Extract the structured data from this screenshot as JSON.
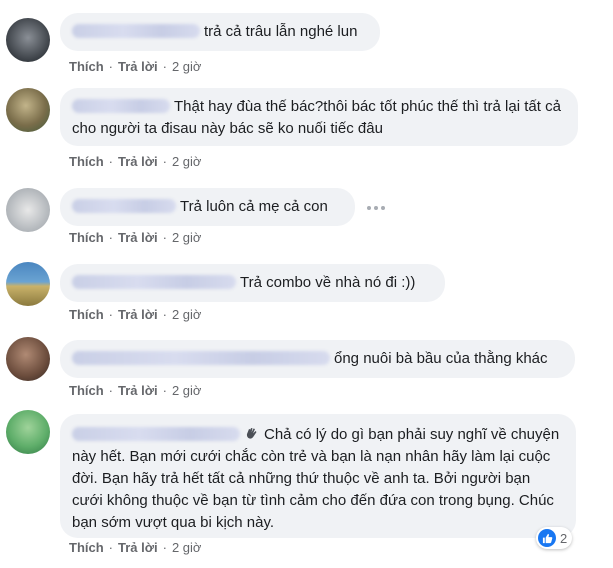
{
  "comments": [
    {
      "text": "trả cả trâu lẫn nghé lun",
      "like": "Thích",
      "reply": "Trả lời",
      "time": "2 giờ"
    },
    {
      "text": "Thật hay đùa thế bác?thôi bác tốt phúc thế thì trả lại tất cả cho người ta đisau này bác sẽ ko nuối tiếc đâu",
      "like": "Thích",
      "reply": "Trả lời",
      "time": "2 giờ"
    },
    {
      "text": "Trả luôn cả mẹ cả con",
      "like": "Thích",
      "reply": "Trả lời",
      "time": "2 giờ"
    },
    {
      "text": "Trả combo về nhà nó đi :))",
      "like": "Thích",
      "reply": "Trả lời",
      "time": "2 giờ"
    },
    {
      "text": "ổng nuôi bà bầu của thằng khác",
      "like": "Thích",
      "reply": "Trả lời",
      "time": "2 giờ"
    },
    {
      "text": "Chả có lý do gì bạn phải suy nghĩ về chuyện này hết. Bạn mới cưới chắc còn trẻ và bạn là nạn nhân hãy làm lại cuộc đời. Bạn hãy trả hết tất cả những thứ thuộc về anh ta. Bởi người bạn cưới không thuộc về bạn từ tình cảm cho đến đứa con trong bụng. Chúc bạn sớm vượt qua bi kịch này.",
      "like": "Thích",
      "reply": "Trả lời",
      "time": "2 giờ",
      "reaction_count": "2"
    }
  ],
  "colors": {
    "bubble": "#f0f2f5",
    "meta": "#65676b",
    "like_blue": "#1877f2"
  }
}
